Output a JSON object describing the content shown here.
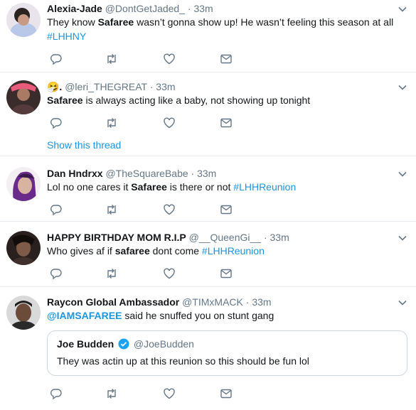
{
  "tweets": [
    {
      "name": "Alexia-Jade",
      "handle": "@DontGetJaded_",
      "sep": "·",
      "time": "33m",
      "text": {
        "a": "They know ",
        "b": "Safaree",
        "c": " wasn’t gonna show up! He wasn’t feeling this season at all",
        "tag": "#LHHNY"
      }
    },
    {
      "name_emoji": "🤧.",
      "handle": "@leri_THEGREAT",
      "sep": "·",
      "time": "33m",
      "text": {
        "b": "Safaree",
        "c": " is always acting like a baby, not showing up tonight"
      },
      "show_thread": "Show this thread"
    },
    {
      "name": "Dan Hndrxx",
      "handle": "@TheSquareBabe",
      "sep": "·",
      "time": "33m",
      "text": {
        "a": "Lol no one cares it ",
        "b": "Safaree",
        "c": " is there or not ",
        "tag": "#LHHReunion"
      }
    },
    {
      "name": "HAPPY BIRTHDAY MOM R.I.P",
      "handle": "@__QueenGi__",
      "sep": "·",
      "time": "33m",
      "text": {
        "a": "Who gives af if ",
        "b": "safaree",
        "c": " dont come ",
        "tag": "#LHHReunion"
      }
    },
    {
      "name": "Raycon Global Ambassador",
      "handle": "@TIMxMACK",
      "sep": "·",
      "time": "33m",
      "text": {
        "mention": "@IAMSAFAREE",
        "c": " said he snuffed you on stunt gang"
      },
      "quote": {
        "name": "Joe Budden",
        "handle": "@JoeBudden",
        "text": "They was actin up at this reunion so this should be fun lol"
      }
    }
  ],
  "colors": {
    "link": "#1b95e0",
    "muted": "#657786",
    "icon": "#657786",
    "border": "#e6ecf0",
    "verified": "#1da1f2"
  },
  "icons": [
    "reply-icon",
    "retweet-icon",
    "like-icon",
    "message-icon",
    "caret-down-icon",
    "verified-badge-icon"
  ]
}
